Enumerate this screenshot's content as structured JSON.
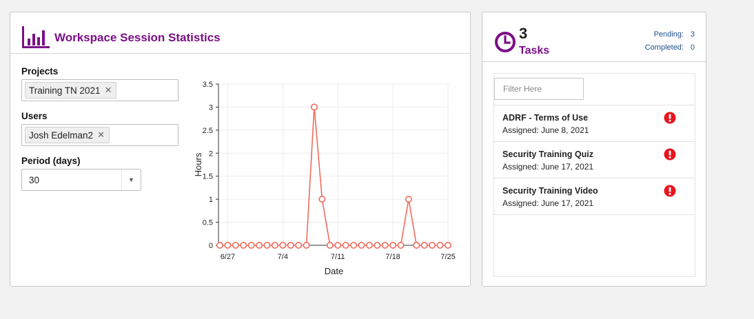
{
  "stats": {
    "title": "Workspace Session Statistics",
    "icon": "bar-chart-icon",
    "accent_color": "#7b0f87",
    "projects_label": "Projects",
    "projects_selected": "Training TN 2021",
    "users_label": "Users",
    "users_selected": "Josh Edelman2",
    "period_label": "Period (days)",
    "period_value": "30",
    "remove_glyph": "✕",
    "dropdown_glyph": "▼"
  },
  "chart_data": {
    "type": "line",
    "xlabel": "Date",
    "ylabel": "Hours",
    "ylim": [
      0,
      3.5
    ],
    "yticks": [
      0,
      0.5,
      1,
      1.5,
      2,
      2.5,
      3,
      3.5
    ],
    "ytick_labels": [
      "0",
      "0.5",
      "1",
      "1.5",
      "2",
      "2.5",
      "3",
      "3.5"
    ],
    "x_start": "6/26",
    "x_end": "7/25",
    "xticks": [
      "6/27",
      "7/4",
      "7/11",
      "7/18",
      "7/25"
    ],
    "grid": true,
    "line_color": "#ef6a5c",
    "series": [
      {
        "x": [
          "6/26",
          "6/27",
          "6/28",
          "6/29",
          "6/30",
          "7/1",
          "7/2",
          "7/3",
          "7/4",
          "7/5",
          "7/6",
          "7/7",
          "7/8",
          "7/9",
          "7/10",
          "7/11",
          "7/12",
          "7/13",
          "7/14",
          "7/15",
          "7/16",
          "7/17",
          "7/18",
          "7/19",
          "7/20",
          "7/21",
          "7/22",
          "7/23",
          "7/24",
          "7/25"
        ],
        "values": [
          0,
          0,
          0,
          0,
          0,
          0,
          0,
          0,
          0,
          0,
          0,
          0,
          3,
          1,
          0,
          0,
          0,
          0,
          0,
          0,
          0,
          0,
          0,
          0,
          1,
          0,
          0,
          0,
          0,
          0
        ]
      }
    ]
  },
  "tasks": {
    "count": "3",
    "label": "Tasks",
    "icon": "clock-icon",
    "pending_label": "Pending:",
    "pending_value": "3",
    "completed_label": "Completed:",
    "completed_value": "0",
    "filter_placeholder": "Filter Here",
    "alert_icon": "exclamation-circle-icon",
    "alert_color": "#e8141e",
    "items": [
      {
        "name": "ADRF - Terms of Use",
        "assigned": "Assigned: June 8, 2021"
      },
      {
        "name": "Security Training Quiz",
        "assigned": "Assigned: June 17, 2021"
      },
      {
        "name": "Security Training Video",
        "assigned": "Assigned: June 17, 2021"
      }
    ]
  }
}
